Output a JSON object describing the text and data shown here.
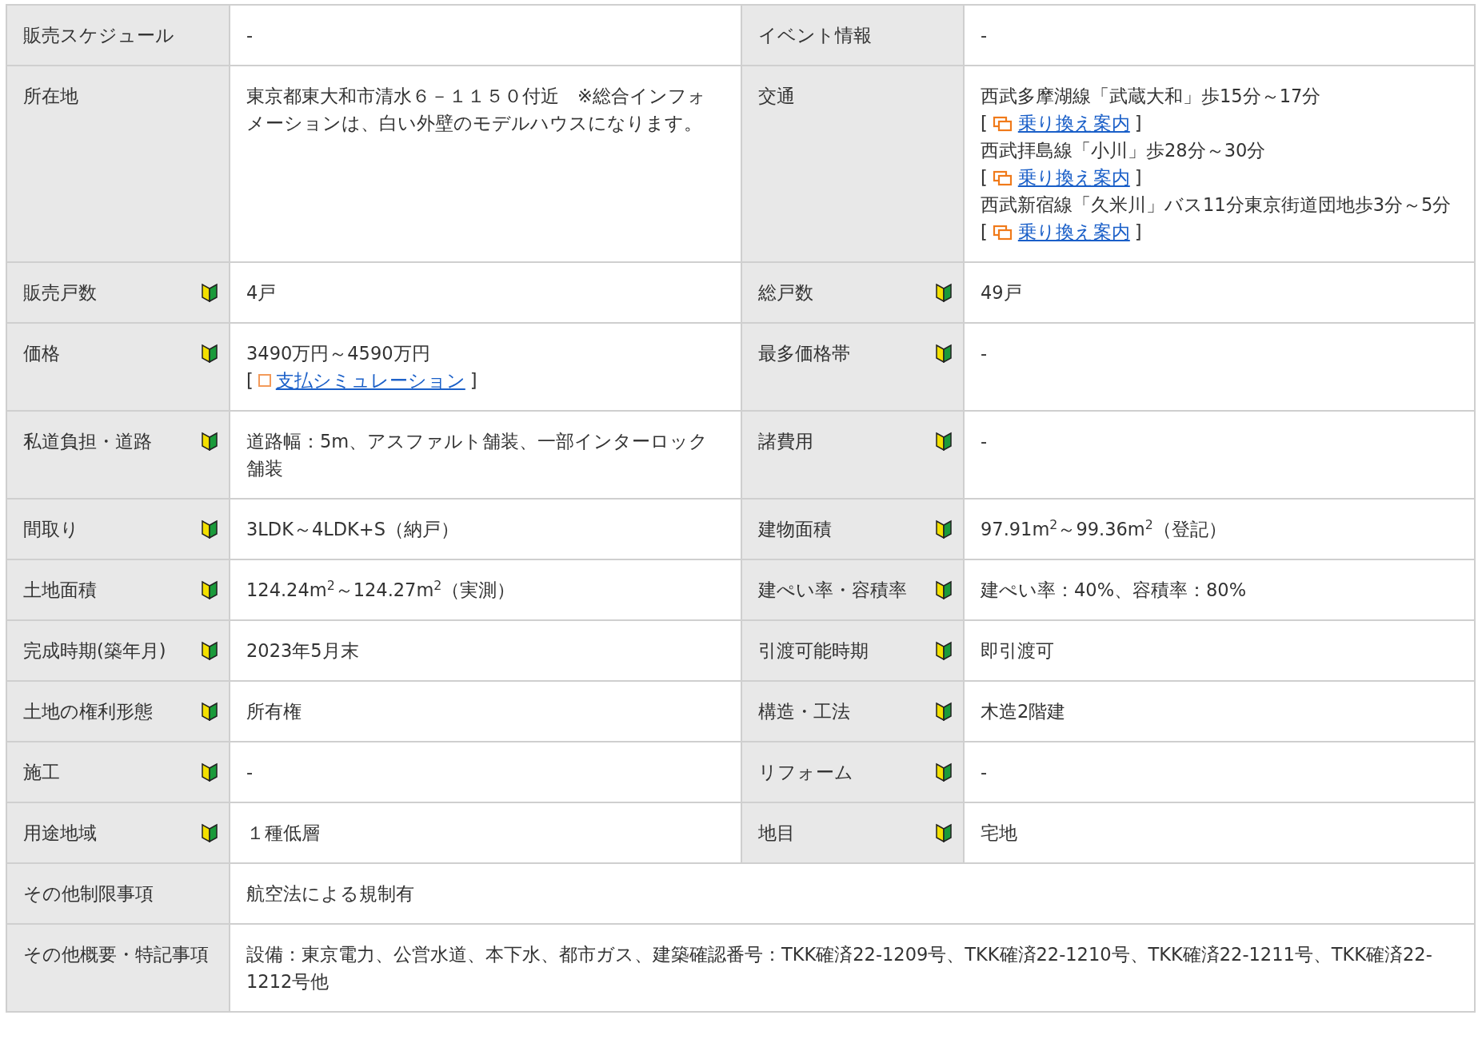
{
  "rows": [
    {
      "cells": [
        {
          "label": "販売スケジュール",
          "help_icon": false,
          "lines": [
            {
              "kind": "text",
              "text": "-"
            }
          ]
        },
        {
          "label": "イベント情報",
          "help_icon": false,
          "lines": [
            {
              "kind": "text",
              "text": "-"
            }
          ]
        }
      ]
    },
    {
      "cells": [
        {
          "label": "所在地",
          "help_icon": false,
          "lines": [
            {
              "kind": "text",
              "text": "東京都東大和市清水６－１１５０付近　※総合インフォメーションは、白い外壁のモデルハウスになります。"
            }
          ]
        },
        {
          "label": "交通",
          "help_icon": false,
          "lines": [
            {
              "kind": "text",
              "text": "西武多摩湖線「武蔵大和」歩15分～17分"
            },
            {
              "kind": "transfer-link",
              "open": "[",
              "text": "乗り換え案内",
              "close": "]"
            },
            {
              "kind": "text",
              "text": "西武拝島線「小川」歩28分～30分"
            },
            {
              "kind": "transfer-link",
              "open": "[",
              "text": "乗り換え案内",
              "close": "]"
            },
            {
              "kind": "text",
              "text": "西武新宿線「久米川」バス11分東京街道団地歩3分～5分"
            },
            {
              "kind": "transfer-link",
              "open": "[",
              "text": "乗り換え案内",
              "close": "]"
            }
          ]
        }
      ]
    },
    {
      "cells": [
        {
          "label": "販売戸数",
          "help_icon": true,
          "lines": [
            {
              "kind": "text",
              "text": "4戸"
            }
          ]
        },
        {
          "label": "総戸数",
          "help_icon": true,
          "lines": [
            {
              "kind": "text",
              "text": "49戸"
            }
          ]
        }
      ]
    },
    {
      "cells": [
        {
          "label": "価格",
          "help_icon": true,
          "lines": [
            {
              "kind": "text",
              "text": "3490万円～4590万円"
            },
            {
              "kind": "sim-link",
              "open": "[",
              "text": "支払シミュレーション",
              "close": "]"
            }
          ]
        },
        {
          "label": "最多価格帯",
          "help_icon": true,
          "lines": [
            {
              "kind": "text",
              "text": "-"
            }
          ]
        }
      ]
    },
    {
      "cells": [
        {
          "label": "私道負担・道路",
          "help_icon": true,
          "lines": [
            {
              "kind": "text",
              "text": "道路幅：5m、アスファルト舗装、一部インターロック舗装"
            }
          ]
        },
        {
          "label": "諸費用",
          "help_icon": true,
          "lines": [
            {
              "kind": "text",
              "text": "-"
            }
          ]
        }
      ]
    },
    {
      "cells": [
        {
          "label": "間取り",
          "help_icon": true,
          "lines": [
            {
              "kind": "text",
              "text": "3LDK～4LDK+S（納戸）"
            }
          ]
        },
        {
          "label": "建物面積",
          "help_icon": true,
          "lines": [
            {
              "kind": "text",
              "text": "97.91m$^{2}$～99.36m$^{2}$（登記）"
            }
          ]
        }
      ]
    },
    {
      "cells": [
        {
          "label": "土地面積",
          "help_icon": true,
          "lines": [
            {
              "kind": "text",
              "text": "124.24m$^{2}$～124.27m$^{2}$（実測）"
            }
          ]
        },
        {
          "label": "建ぺい率・容積率",
          "help_icon": true,
          "lines": [
            {
              "kind": "text",
              "text": "建ぺい率：40%、容積率：80%"
            }
          ]
        }
      ]
    },
    {
      "cells": [
        {
          "label": "完成時期(築年月)",
          "help_icon": true,
          "lines": [
            {
              "kind": "text",
              "text": "2023年5月末"
            }
          ]
        },
        {
          "label": "引渡可能時期",
          "help_icon": true,
          "lines": [
            {
              "kind": "text",
              "text": "即引渡可"
            }
          ]
        }
      ]
    },
    {
      "cells": [
        {
          "label": "土地の権利形態",
          "help_icon": true,
          "lines": [
            {
              "kind": "text",
              "text": "所有権"
            }
          ]
        },
        {
          "label": "構造・工法",
          "help_icon": true,
          "lines": [
            {
              "kind": "text",
              "text": "木造2階建"
            }
          ]
        }
      ]
    },
    {
      "cells": [
        {
          "label": "施工",
          "help_icon": true,
          "lines": [
            {
              "kind": "text",
              "text": "-"
            }
          ]
        },
        {
          "label": "リフォーム",
          "help_icon": true,
          "lines": [
            {
              "kind": "text",
              "text": "-"
            }
          ]
        }
      ]
    },
    {
      "cells": [
        {
          "label": "用途地域",
          "help_icon": true,
          "lines": [
            {
              "kind": "text",
              "text": "１種低層"
            }
          ]
        },
        {
          "label": "地目",
          "help_icon": true,
          "lines": [
            {
              "kind": "text",
              "text": "宅地"
            }
          ]
        }
      ]
    },
    {
      "cells": [
        {
          "label": "その他制限事項",
          "help_icon": false,
          "lines": [
            {
              "kind": "text",
              "text": "航空法による規制有"
            }
          ]
        }
      ]
    },
    {
      "cells": [
        {
          "label": "その他概要・特記事項",
          "help_icon": false,
          "lines": [
            {
              "kind": "text",
              "text": "設備：東京電力、公営水道、本下水、都市ガス、建築確認番号：TKK確済22-1209号、TKK確済22-1210号、TKK確済22-1211号、TKK確済22-1212号他"
            }
          ]
        }
      ]
    }
  ]
}
